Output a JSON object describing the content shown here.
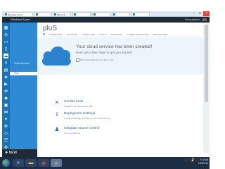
{
  "browser": {
    "tabs": [
      {
        "label": "Windows Azure",
        "active": true
      },
      {
        "label": "",
        "active": false
      },
      {
        "label": "Microsoft",
        "active": false
      },
      {
        "label": "",
        "active": false
      },
      {
        "label": "",
        "active": false
      },
      {
        "label": "",
        "active": false
      },
      {
        "label": "",
        "active": false
      }
    ]
  },
  "portal": {
    "logo": "Windows Azure",
    "subscription": "Subscriptions"
  },
  "sidebar": {
    "items": [
      "Cloud Services",
      "",
      ""
    ],
    "selected": "Plus"
  },
  "page": {
    "title": "pluS",
    "toolbar": [
      "DASHBOARD",
      "MONITOR",
      "CONFIGURE",
      "SCALE",
      "INSTANCES",
      "LINKED RESOURCES",
      "CERTIFICATES"
    ]
  },
  "banner": {
    "headline": "Your cloud service has been created!",
    "subtitle": "Here are a few steps to get you started:",
    "skip_label": "Skip Quick Start the next time I visit"
  },
  "actions": [
    {
      "icon": "tools-icon",
      "title": "Get the tools",
      "desc": "Install the Windows Azure SDK"
    },
    {
      "icon": "upload-icon",
      "title": "Deployment Settings",
      "desc": "Upload a package to deploy to your cloud service"
    },
    {
      "icon": "person-icon",
      "title": "Integrate source control",
      "desc": "Set up publishing"
    }
  ],
  "footer": {
    "new_label": "NEW"
  },
  "taskbar": {
    "time": "9:12 AM",
    "date": "10/9/2013"
  },
  "watermark": {
    "prefix": "in",
    "circle": "2",
    "suffix": "it"
  },
  "colors": {
    "accent": "#1a73b8",
    "nav": "#2e8ad4",
    "header": "#1e2a37"
  }
}
